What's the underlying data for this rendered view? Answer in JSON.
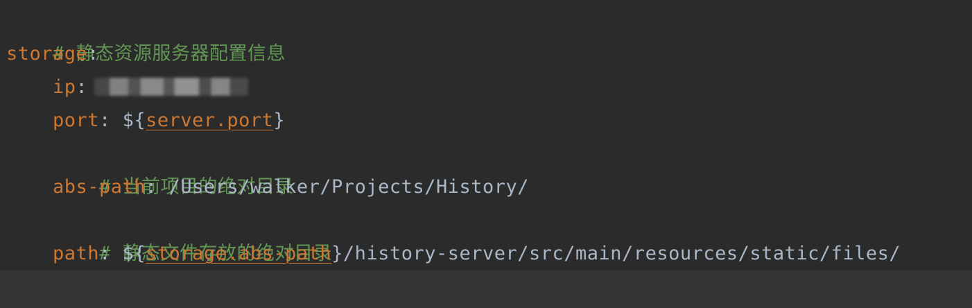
{
  "lines": {
    "comment_static": "# 静态资源服务器配置信息",
    "storage_key": "storage",
    "colon": ":",
    "ip_key": "ip",
    "port_key": "port",
    "port_prefix": "${",
    "port_ref": "server.port",
    "port_suffix": "}",
    "comment_project": "# 当前项目的绝对目录",
    "abs_path_key": "abs-path",
    "abs_path_value": "/Users/walker/Projects/History/",
    "comment_files": "# 静态文件存放的绝对目录",
    "path_key": "path",
    "path_prefix": "${",
    "path_ref": "storage.abs-path",
    "path_suffix": "}/history-server/src/main/resources/static/files/"
  },
  "colors": {
    "background": "#2b2b2b",
    "comment": "#629755",
    "key": "#cc7832",
    "text": "#a9b7c6"
  }
}
